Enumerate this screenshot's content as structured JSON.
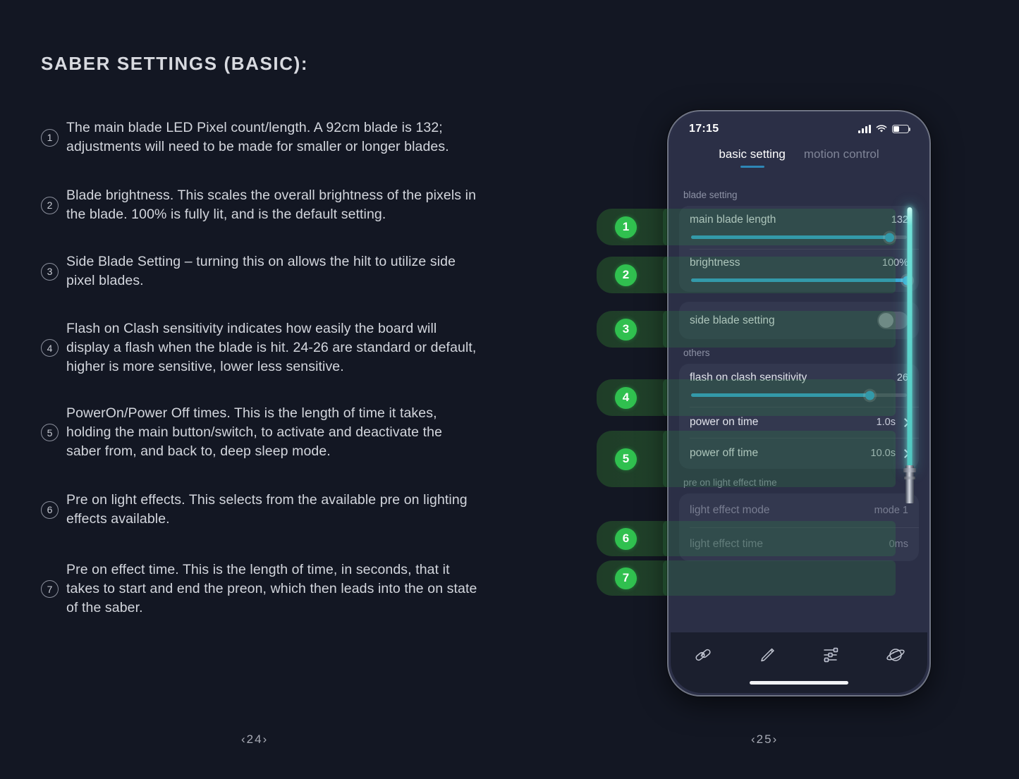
{
  "document": {
    "title": "SABER SETTINGS (BASIC):",
    "page_left": "‹24›",
    "page_right": "‹25›"
  },
  "items": [
    {
      "num": "1",
      "text": "The main blade LED Pixel count/length. A 92cm blade is 132; adjustments will need to be made for smaller or longer  blades."
    },
    {
      "num": "2",
      "text": "Blade brightness. This scales the overall brightness of the pixels in the blade. 100% is fully lit, and is the default setting."
    },
    {
      "num": "3",
      "text": "Side Blade Setting – turning this on allows the hilt to utilize side pixel blades."
    },
    {
      "num": "4",
      "text": "Flash on Clash sensitivity indicates how easily the board will display a flash when the blade is hit. 24-26 are standard or default, higher is more sensitive, lower less sensitive."
    },
    {
      "num": "5",
      "text": "PowerOn/Power Off times. This is the length of time it takes, holding the main button/switch, to activate and deactivate the saber from, and back to, deep sleep mode."
    },
    {
      "num": "6",
      "text": "Pre on light effects. This selects from the available pre on lighting effects available."
    },
    {
      "num": "7",
      "text": "Pre on effect time. This is the length of time, in seconds, that it takes to start and end the preon, which then leads into the on state of the saber."
    }
  ],
  "callout_badges": [
    "1",
    "2",
    "3",
    "4",
    "5",
    "6",
    "7"
  ],
  "phone": {
    "status": {
      "time": "17:15",
      "signal_icon": "signal-bars-icon",
      "wifi_icon": "wifi-icon",
      "battery_icon": "battery-icon",
      "battery_level": 42
    },
    "tabs": [
      {
        "label": "basic setting",
        "active": true
      },
      {
        "label": "motion control",
        "active": false
      }
    ],
    "sections": [
      {
        "label": "blade setting"
      },
      {
        "label": "others"
      },
      {
        "label": "pre on light effect time"
      }
    ],
    "settings": {
      "main_blade_length": {
        "label": "main blade length",
        "value": "132",
        "slider_pct": 92
      },
      "brightness": {
        "label": "brightness",
        "value": "100%",
        "slider_pct": 100
      },
      "side_blade_setting": {
        "label": "side blade setting",
        "toggle": "off"
      },
      "flash_on_clash": {
        "label": "flash on clash sensitivity",
        "value": "26",
        "slider_pct": 83
      },
      "power_on_time": {
        "label": "power on time",
        "value": "1.0s"
      },
      "power_off_time": {
        "label": "power off time",
        "value": "10.0s"
      },
      "light_effect_mode": {
        "label": "light effect mode",
        "value": "mode 1"
      },
      "light_effect_time": {
        "label": "light effect time",
        "value": "0ms"
      }
    },
    "tabbar": [
      {
        "icon": "chain-link-icon"
      },
      {
        "icon": "saber-wand-icon"
      },
      {
        "icon": "sliders-icon"
      },
      {
        "icon": "planet-icon"
      }
    ]
  },
  "colors": {
    "page_bg": "#131723",
    "accent_blue": "#36a6d4",
    "badge_green": "#30c04f",
    "saber_cyan": "#6fe0d7"
  }
}
